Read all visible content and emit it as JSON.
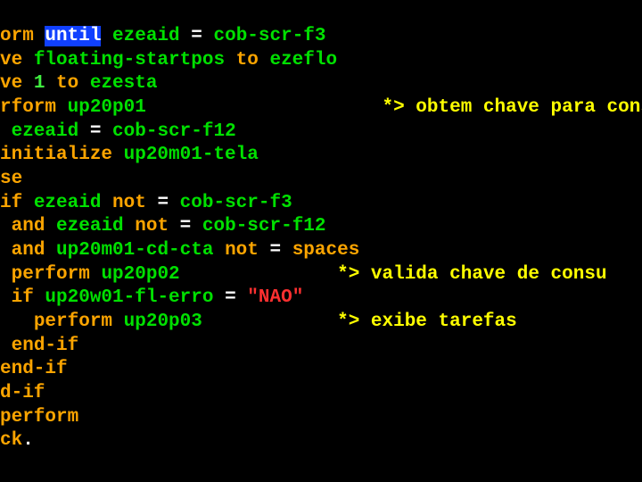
{
  "lines": [
    {
      "indent": "",
      "tokens": [
        {
          "cls": "orange",
          "text": "orm "
        },
        {
          "cls": "sel",
          "text": "until"
        },
        {
          "cls": "green",
          "text": " ezeaid "
        },
        {
          "cls": "white",
          "text": "= "
        },
        {
          "cls": "green",
          "text": "cob-scr-f3"
        }
      ]
    },
    {
      "indent": "",
      "tokens": [
        {
          "cls": "orange",
          "text": "ve "
        },
        {
          "cls": "green",
          "text": "floating-startpos "
        },
        {
          "cls": "orange",
          "text": "to "
        },
        {
          "cls": "green",
          "text": "ezeflo"
        }
      ]
    },
    {
      "indent": "",
      "tokens": [
        {
          "cls": "orange",
          "text": "ve "
        },
        {
          "cls": "lightgreen",
          "text": "1 "
        },
        {
          "cls": "orange",
          "text": "to "
        },
        {
          "cls": "green",
          "text": "ezesta"
        }
      ]
    },
    {
      "indent": "",
      "tokens": [
        {
          "cls": "orange",
          "text": "rform "
        },
        {
          "cls": "green",
          "text": "up20p01                     "
        },
        {
          "cls": "yellow",
          "text": "*> obtem chave para cons"
        }
      ]
    },
    {
      "indent": "",
      "tokens": [
        {
          "cls": "green",
          "text": " ezeaid "
        },
        {
          "cls": "white",
          "text": "= "
        },
        {
          "cls": "green",
          "text": "cob-scr-f12"
        }
      ]
    },
    {
      "indent": "",
      "tokens": [
        {
          "cls": "orange",
          "text": "initialize "
        },
        {
          "cls": "green",
          "text": "up20m01-tela"
        }
      ]
    },
    {
      "indent": "",
      "tokens": [
        {
          "cls": "orange",
          "text": "se"
        }
      ]
    },
    {
      "indent": "",
      "tokens": [
        {
          "cls": "orange",
          "text": "if "
        },
        {
          "cls": "green",
          "text": "ezeaid "
        },
        {
          "cls": "orange",
          "text": "not "
        },
        {
          "cls": "white",
          "text": "= "
        },
        {
          "cls": "green",
          "text": "cob-scr-f3"
        }
      ]
    },
    {
      "indent": " ",
      "tokens": [
        {
          "cls": "orange",
          "text": "and "
        },
        {
          "cls": "green",
          "text": "ezeaid "
        },
        {
          "cls": "orange",
          "text": "not "
        },
        {
          "cls": "white",
          "text": "= "
        },
        {
          "cls": "green",
          "text": "cob-scr-f12"
        }
      ]
    },
    {
      "indent": " ",
      "tokens": [
        {
          "cls": "orange",
          "text": "and "
        },
        {
          "cls": "green",
          "text": "up20m01-cd-cta "
        },
        {
          "cls": "orange",
          "text": "not "
        },
        {
          "cls": "white",
          "text": "= "
        },
        {
          "cls": "orange",
          "text": "spaces"
        }
      ]
    },
    {
      "indent": " ",
      "tokens": [
        {
          "cls": "orange",
          "text": "perform "
        },
        {
          "cls": "green",
          "text": "up20p02              "
        },
        {
          "cls": "yellow",
          "text": "*> valida chave de consu"
        }
      ]
    },
    {
      "indent": " ",
      "tokens": [
        {
          "cls": "orange",
          "text": "if "
        },
        {
          "cls": "green",
          "text": "up20w01-fl-erro "
        },
        {
          "cls": "white",
          "text": "= "
        },
        {
          "cls": "red",
          "text": "\"NAO\""
        }
      ]
    },
    {
      "indent": "   ",
      "tokens": [
        {
          "cls": "orange",
          "text": "perform "
        },
        {
          "cls": "green",
          "text": "up20p03            "
        },
        {
          "cls": "yellow",
          "text": "*> exibe tarefas"
        }
      ]
    },
    {
      "indent": " ",
      "tokens": [
        {
          "cls": "orange",
          "text": "end-if"
        }
      ]
    },
    {
      "indent": "",
      "tokens": [
        {
          "cls": "orange",
          "text": "end-if"
        }
      ]
    },
    {
      "indent": "",
      "tokens": [
        {
          "cls": "orange",
          "text": "d-if"
        }
      ]
    },
    {
      "indent": "",
      "tokens": [
        {
          "cls": "orange",
          "text": "perform"
        }
      ]
    },
    {
      "indent": "",
      "tokens": [
        {
          "cls": "orange",
          "text": "ck"
        },
        {
          "cls": "white",
          "text": "."
        }
      ]
    }
  ]
}
